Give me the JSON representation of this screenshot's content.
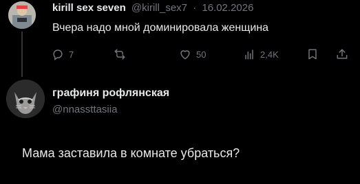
{
  "tweet1": {
    "author_name": "kirill sex seven",
    "handle": "@kirill_sex7",
    "separator": "·",
    "date": "16.02.2026",
    "text": "Вчера надо мной доминировала женщина",
    "actions": {
      "replies": "7",
      "retweets": "",
      "likes": "50",
      "views": "2,4K"
    }
  },
  "tweet2": {
    "author_name": "графиня рофлянская",
    "handle": "@nnassttasiia",
    "text": "Мама заставила в комнате убраться?"
  },
  "icons": {
    "reply": "reply-icon",
    "retweet": "retweet-icon",
    "like": "heart-icon",
    "views": "views-icon",
    "bookmark": "bookmark-icon",
    "share": "share-icon"
  },
  "colors": {
    "background": "#000000",
    "text": "#e7e9ea",
    "muted": "#71767b",
    "divider": "#333639"
  }
}
